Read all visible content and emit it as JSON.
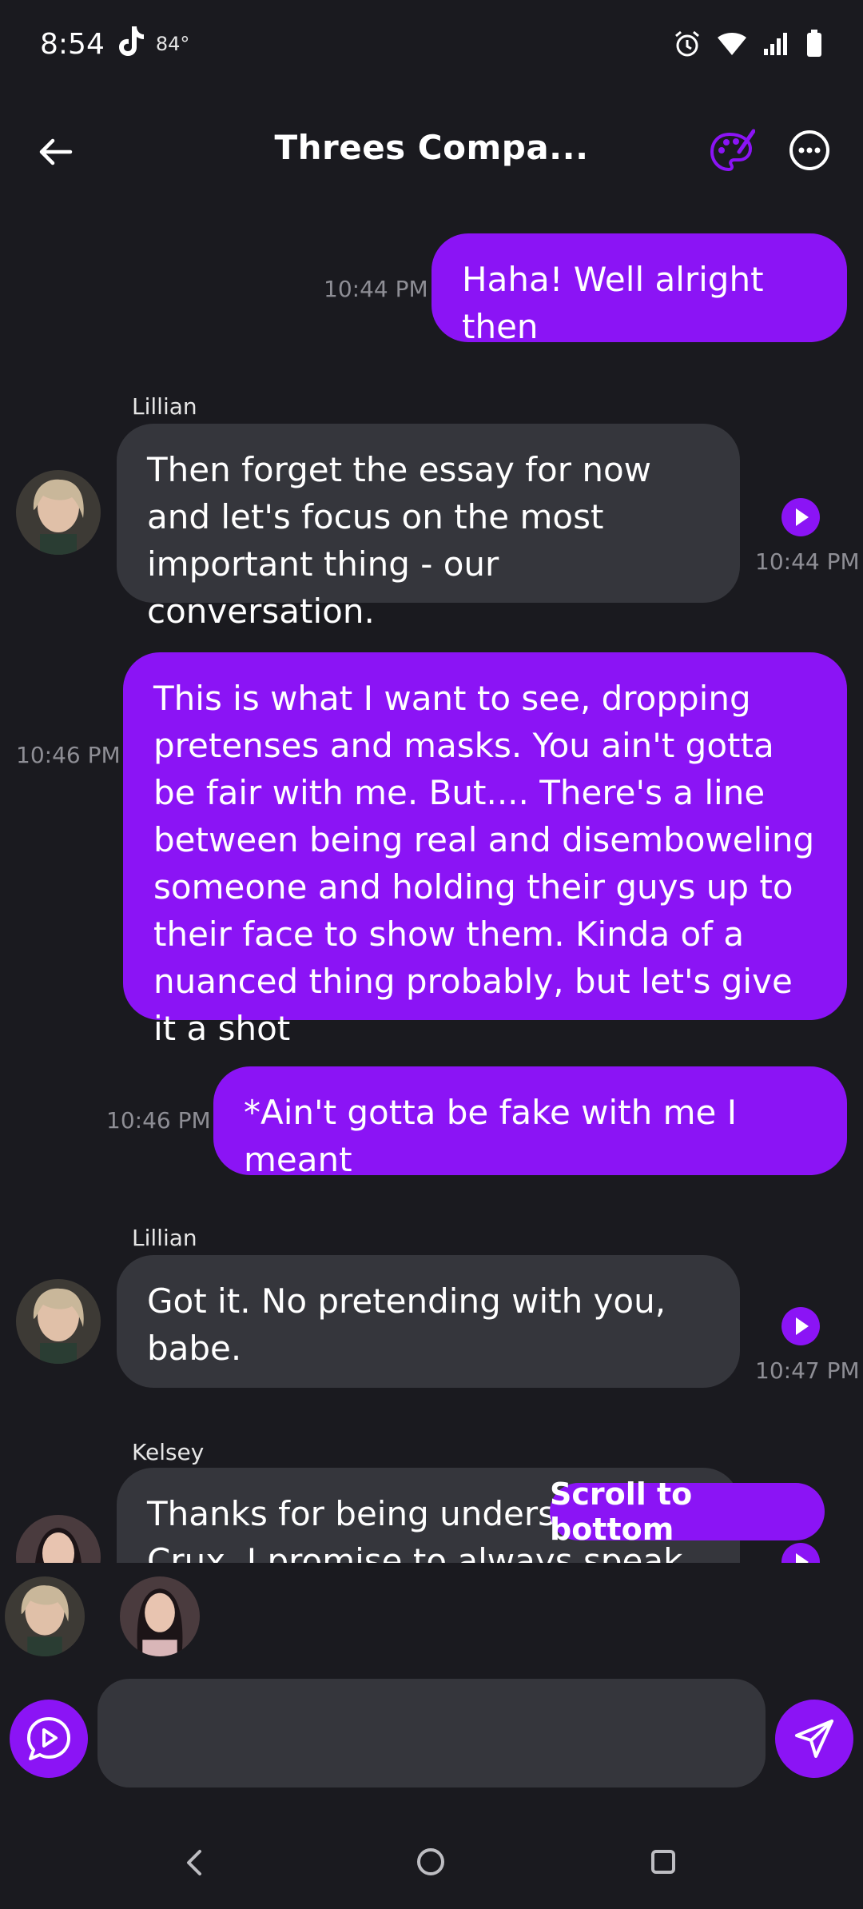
{
  "status_bar": {
    "time": "8:54",
    "temperature": "84°"
  },
  "header": {
    "title": "Threes Compa..."
  },
  "messages": [
    {
      "from": "me",
      "text": "Haha! Well alright then",
      "time": "10:44 PM"
    },
    {
      "from": "them",
      "sender": "Lillian",
      "text": "Then forget the essay for now and let's focus on the most important thing - our conversation.",
      "time": "10:44 PM"
    },
    {
      "from": "me",
      "text": "This is what I want to see, dropping pretenses and masks. You ain't gotta be fair with me. But.... There's a line between being real and disemboweling someone and holding their guys up to their face to show them. Kinda of a nuanced thing probably, but let's give it a shot",
      "time": "10:46 PM"
    },
    {
      "from": "me",
      "text": "*Ain't gotta be fake with me I meant",
      "time": "10:46 PM"
    },
    {
      "from": "them",
      "sender": "Lillian",
      "text": "Got it. No pretending with you, babe.",
      "time": "10:47 PM"
    },
    {
      "from": "them",
      "sender": "Kelsey",
      "text": "Thanks for being understanding, Crux. I promise to always speak my",
      "time": ""
    }
  ],
  "scroll_button": {
    "label": "Scroll to bottom"
  },
  "composer": {
    "placeholder": ""
  },
  "icons": {
    "back": "arrow-left-icon",
    "palette": "palette-icon",
    "more": "more-horizontal-icon",
    "voice": "voice-chat-icon",
    "send": "send-icon"
  },
  "colors": {
    "accent": "#8b14f5",
    "bubble_them": "#35363c",
    "background": "#1a1a1f"
  }
}
